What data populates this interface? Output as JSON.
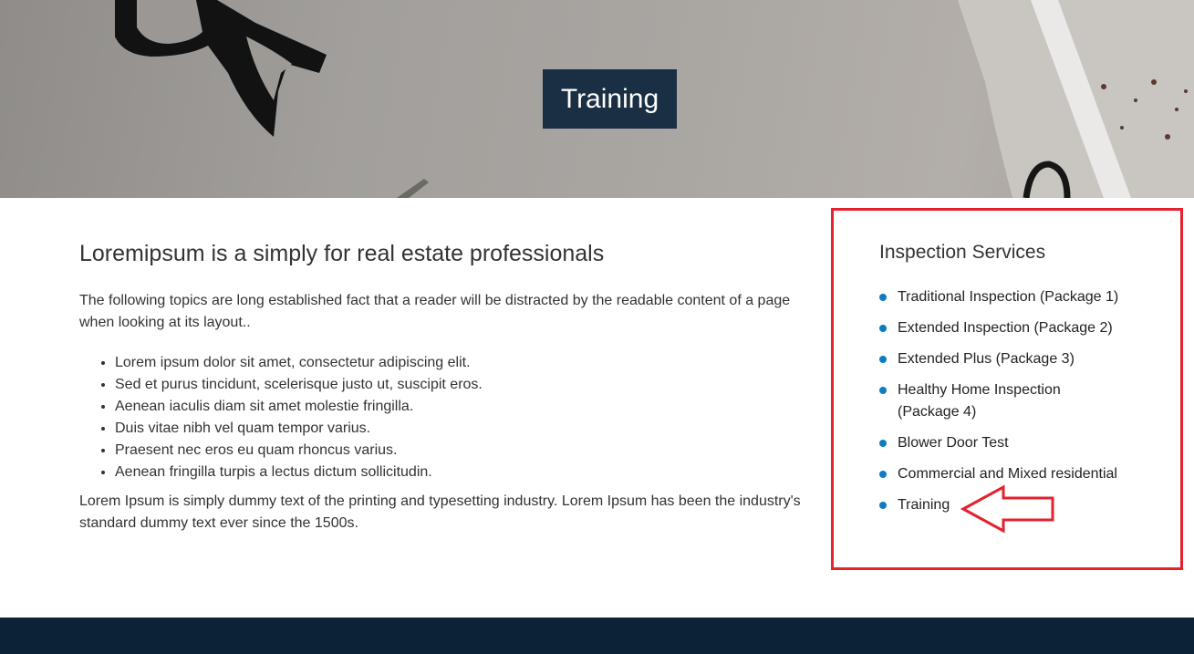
{
  "hero": {
    "title": "Training"
  },
  "main": {
    "heading": "Loremipsum is a simply for real estate professionals",
    "intro": "The following topics are long established fact that a reader will be distracted by the readable content of a page when looking at its layout..",
    "points": [
      "Lorem ipsum dolor sit amet, consectetur adipiscing elit.",
      "Sed et purus tincidunt, scelerisque justo ut, suscipit eros.",
      "Aenean iaculis diam sit amet molestie fringilla.",
      "Duis vitae nibh vel quam tempor varius.",
      "Praesent nec eros eu quam rhoncus varius.",
      "Aenean fringilla turpis a lectus dictum sollicitudin."
    ],
    "outro": "Lorem Ipsum is simply dummy text of the printing and typesetting industry. Lorem Ipsum has been the industry's standard dummy text ever since the 1500s."
  },
  "sidebar": {
    "heading": "Inspection Services",
    "items": [
      "Traditional Inspection (Package 1)",
      "Extended Inspection (Package 2)",
      "Extended Plus (Package 3)",
      "Healthy Home Inspection (Package 4)",
      "Blower Door Test",
      "Commercial and Mixed residential",
      "Training"
    ]
  },
  "colors": {
    "title_box": "#1a2e44",
    "annotation_red": "#e3222e",
    "bullet_blue": "#0d7cc1",
    "footer": "#0c2237"
  }
}
